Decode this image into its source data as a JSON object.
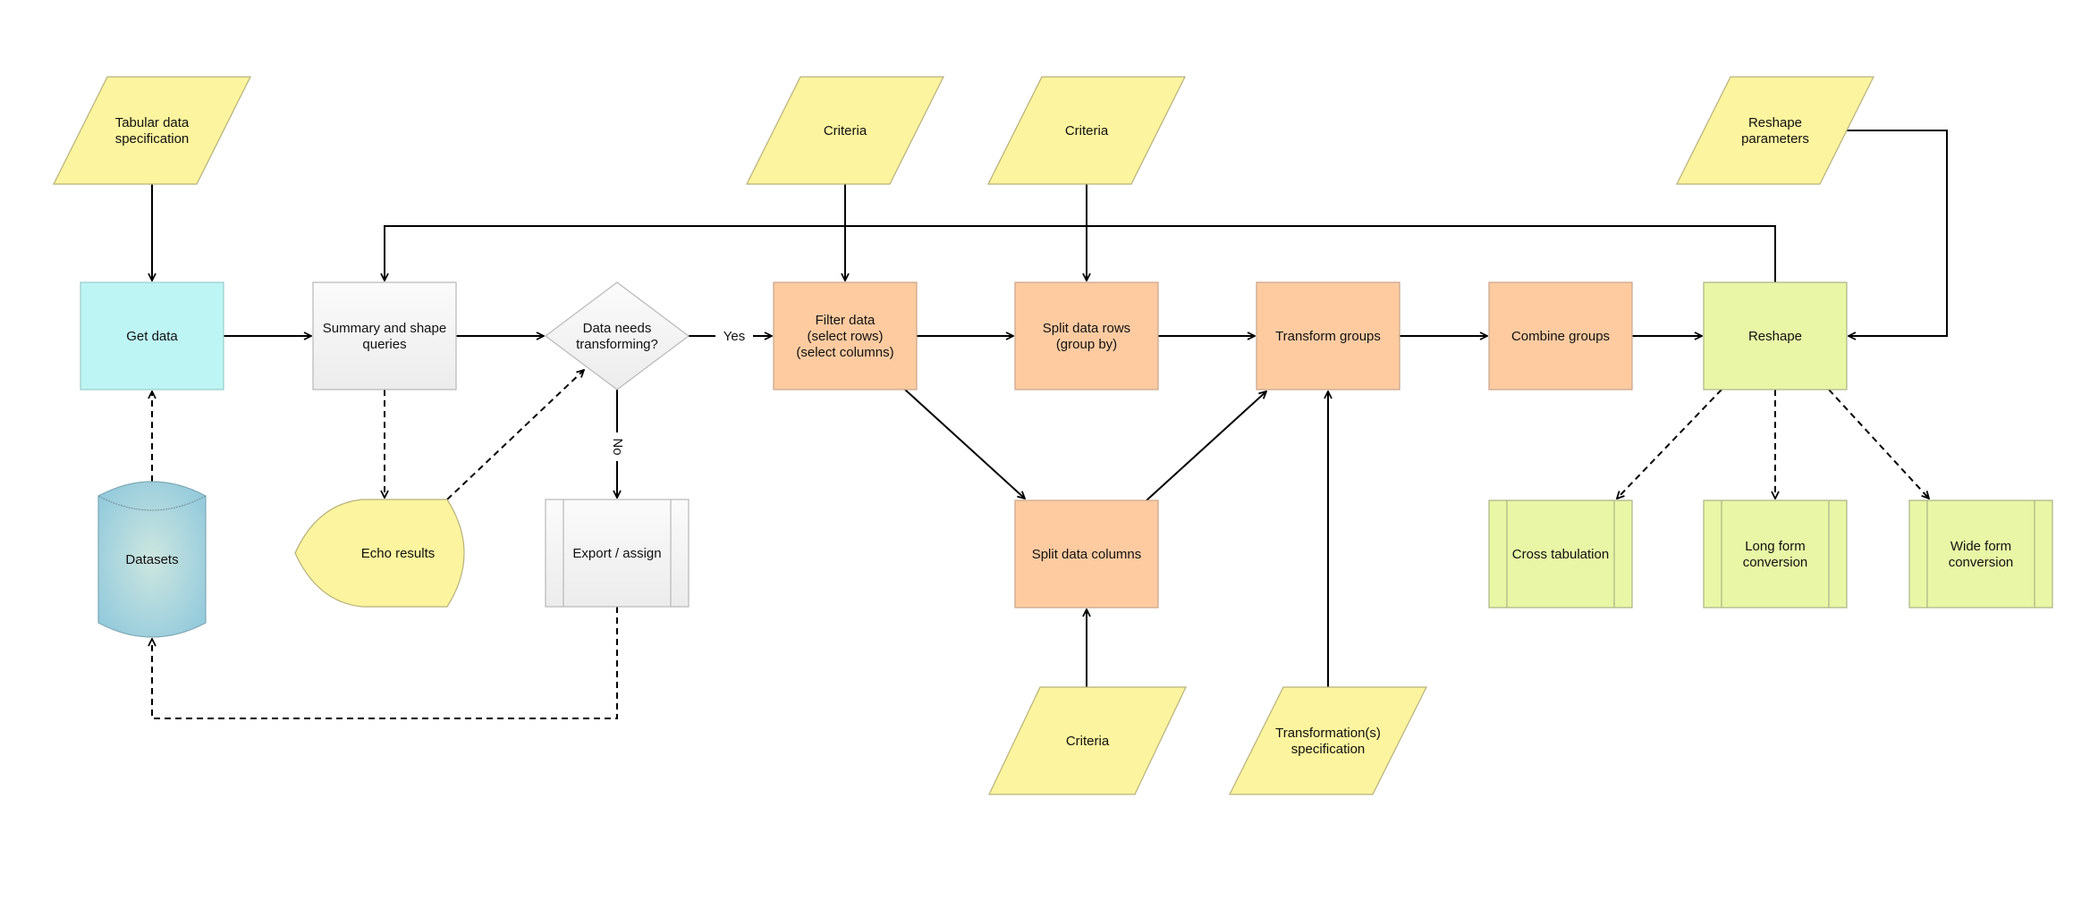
{
  "diagram": {
    "type": "flowchart",
    "colors": {
      "input": "#fcf49e",
      "input_stroke": "#b8b07a",
      "start": "#bdf5f5",
      "start_stroke": "#9ccaca",
      "neutral": "#f2f2f2",
      "neutral_stroke": "#b8b8b8",
      "transform": "#fecba1",
      "transform_stroke": "#c9a488",
      "reshape": "#e8f6a6",
      "reshape_stroke": "#a9b486",
      "database": "#9bcfe0",
      "database_light": "#c9e6e2",
      "database_stroke": "#7fa8b6",
      "edge": "#000000"
    },
    "nodes": {
      "tabular_spec": {
        "label": [
          "Tabular data",
          "specification"
        ],
        "kind": "input"
      },
      "criteria_filter": {
        "label": [
          "Criteria"
        ],
        "kind": "input"
      },
      "criteria_split_rows": {
        "label": [
          "Criteria"
        ],
        "kind": "input"
      },
      "reshape_params": {
        "label": [
          "Reshape",
          "parameters"
        ],
        "kind": "input"
      },
      "get_data": {
        "label": [
          "Get data"
        ],
        "kind": "process"
      },
      "summary": {
        "label": [
          "Summary and shape",
          "queries"
        ],
        "kind": "process"
      },
      "decision": {
        "label": [
          "Data needs",
          "transforming?"
        ],
        "kind": "decision"
      },
      "filter": {
        "label": [
          "Filter data",
          "(select rows)",
          "(select columns)"
        ],
        "kind": "process"
      },
      "split_rows": {
        "label": [
          "Split data rows",
          "(group by)"
        ],
        "kind": "process"
      },
      "transform_groups": {
        "label": [
          "Transform groups"
        ],
        "kind": "process"
      },
      "combine_groups": {
        "label": [
          "Combine groups"
        ],
        "kind": "process"
      },
      "reshape": {
        "label": [
          "Reshape"
        ],
        "kind": "process"
      },
      "datasets": {
        "label": [
          "Datasets"
        ],
        "kind": "database"
      },
      "echo": {
        "label": [
          "Echo results"
        ],
        "kind": "display"
      },
      "export": {
        "label": [
          "Export / assign"
        ],
        "kind": "predefined-process"
      },
      "split_columns": {
        "label": [
          "Split data columns"
        ],
        "kind": "process"
      },
      "cross_tab": {
        "label": [
          "Cross tabulation"
        ],
        "kind": "predefined-process"
      },
      "long_form": {
        "label": [
          "Long form",
          "conversion"
        ],
        "kind": "predefined-process"
      },
      "wide_form": {
        "label": [
          "Wide form",
          "conversion"
        ],
        "kind": "predefined-process"
      },
      "criteria_split_cols": {
        "label": [
          "Criteria"
        ],
        "kind": "input"
      },
      "transform_spec": {
        "label": [
          "Transformation(s)",
          "specification"
        ],
        "kind": "input"
      }
    },
    "edges": [
      {
        "from": "tabular_spec",
        "to": "get_data",
        "style": "solid"
      },
      {
        "from": "get_data",
        "to": "summary",
        "style": "solid"
      },
      {
        "from": "summary",
        "to": "decision",
        "style": "solid"
      },
      {
        "from": "decision",
        "to": "filter",
        "style": "solid",
        "label": "Yes"
      },
      {
        "from": "decision",
        "to": "export",
        "style": "solid",
        "label": "No"
      },
      {
        "from": "criteria_filter",
        "to": "filter",
        "style": "solid"
      },
      {
        "from": "criteria_split_rows",
        "to": "split_rows",
        "style": "solid"
      },
      {
        "from": "filter",
        "to": "split_rows",
        "style": "solid"
      },
      {
        "from": "split_rows",
        "to": "transform_groups",
        "style": "solid"
      },
      {
        "from": "transform_groups",
        "to": "combine_groups",
        "style": "solid"
      },
      {
        "from": "combine_groups",
        "to": "reshape",
        "style": "solid"
      },
      {
        "from": "reshape",
        "to": "summary",
        "style": "solid"
      },
      {
        "from": "reshape_params",
        "to": "reshape",
        "style": "solid"
      },
      {
        "from": "filter",
        "to": "split_columns",
        "style": "solid"
      },
      {
        "from": "split_columns",
        "to": "transform_groups",
        "style": "solid"
      },
      {
        "from": "criteria_split_cols",
        "to": "split_columns",
        "style": "solid"
      },
      {
        "from": "transform_spec",
        "to": "transform_groups",
        "style": "solid"
      },
      {
        "from": "datasets",
        "to": "get_data",
        "style": "dashed"
      },
      {
        "from": "summary",
        "to": "echo",
        "style": "dashed"
      },
      {
        "from": "echo",
        "to": "decision",
        "style": "dashed"
      },
      {
        "from": "export",
        "to": "datasets",
        "style": "dashed"
      },
      {
        "from": "reshape",
        "to": "cross_tab",
        "style": "dashed"
      },
      {
        "from": "reshape",
        "to": "long_form",
        "style": "dashed"
      },
      {
        "from": "reshape",
        "to": "wide_form",
        "style": "dashed"
      }
    ],
    "edge_labels": {
      "yes": "Yes",
      "no": "No"
    }
  }
}
